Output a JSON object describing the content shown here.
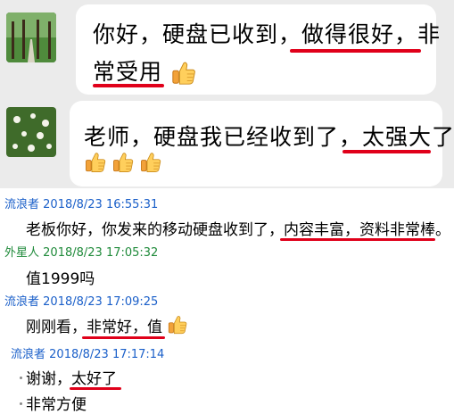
{
  "wechat": {
    "messages": [
      {
        "line1_plain": "你好，硬盘已收到，",
        "line1_underlined": "做得很好，非",
        "line2_underlined": "常受用",
        "emoji": "thumbs-up"
      },
      {
        "line1_plain": "老师，硬盘我已经收到了，",
        "line1_underlined": "太强大了",
        "emoji": "thumbs-up x3"
      }
    ]
  },
  "qq": {
    "messages": [
      {
        "sender": "流浪者",
        "time": "2018/8/23 16:55:31",
        "sender_color": "#1a5fc9",
        "text_plain": "老板你好，你发来的移动硬盘收到了，",
        "text_underlined": "内容丰富，资料非常棒。"
      },
      {
        "sender": "外星人",
        "time": "2018/8/23 17:05:32",
        "sender_color": "#1f8a3a",
        "text_plain": "值1999吗"
      },
      {
        "sender": "流浪者",
        "time": "2018/8/23 17:09:25",
        "sender_color": "#1a5fc9",
        "text_plain": "刚刚看，",
        "text_underlined": "非常好，值"
      },
      {
        "sender": "流浪者",
        "time": "2018/8/23 17:17:14",
        "sender_color": "#1a5fc9",
        "text_plain": "谢谢，",
        "text_underlined": "太好了",
        "text_line2": "非常方便"
      }
    ]
  },
  "colors": {
    "highlight_underline": "#e0001a",
    "wechat_background": "#ebebeb"
  }
}
